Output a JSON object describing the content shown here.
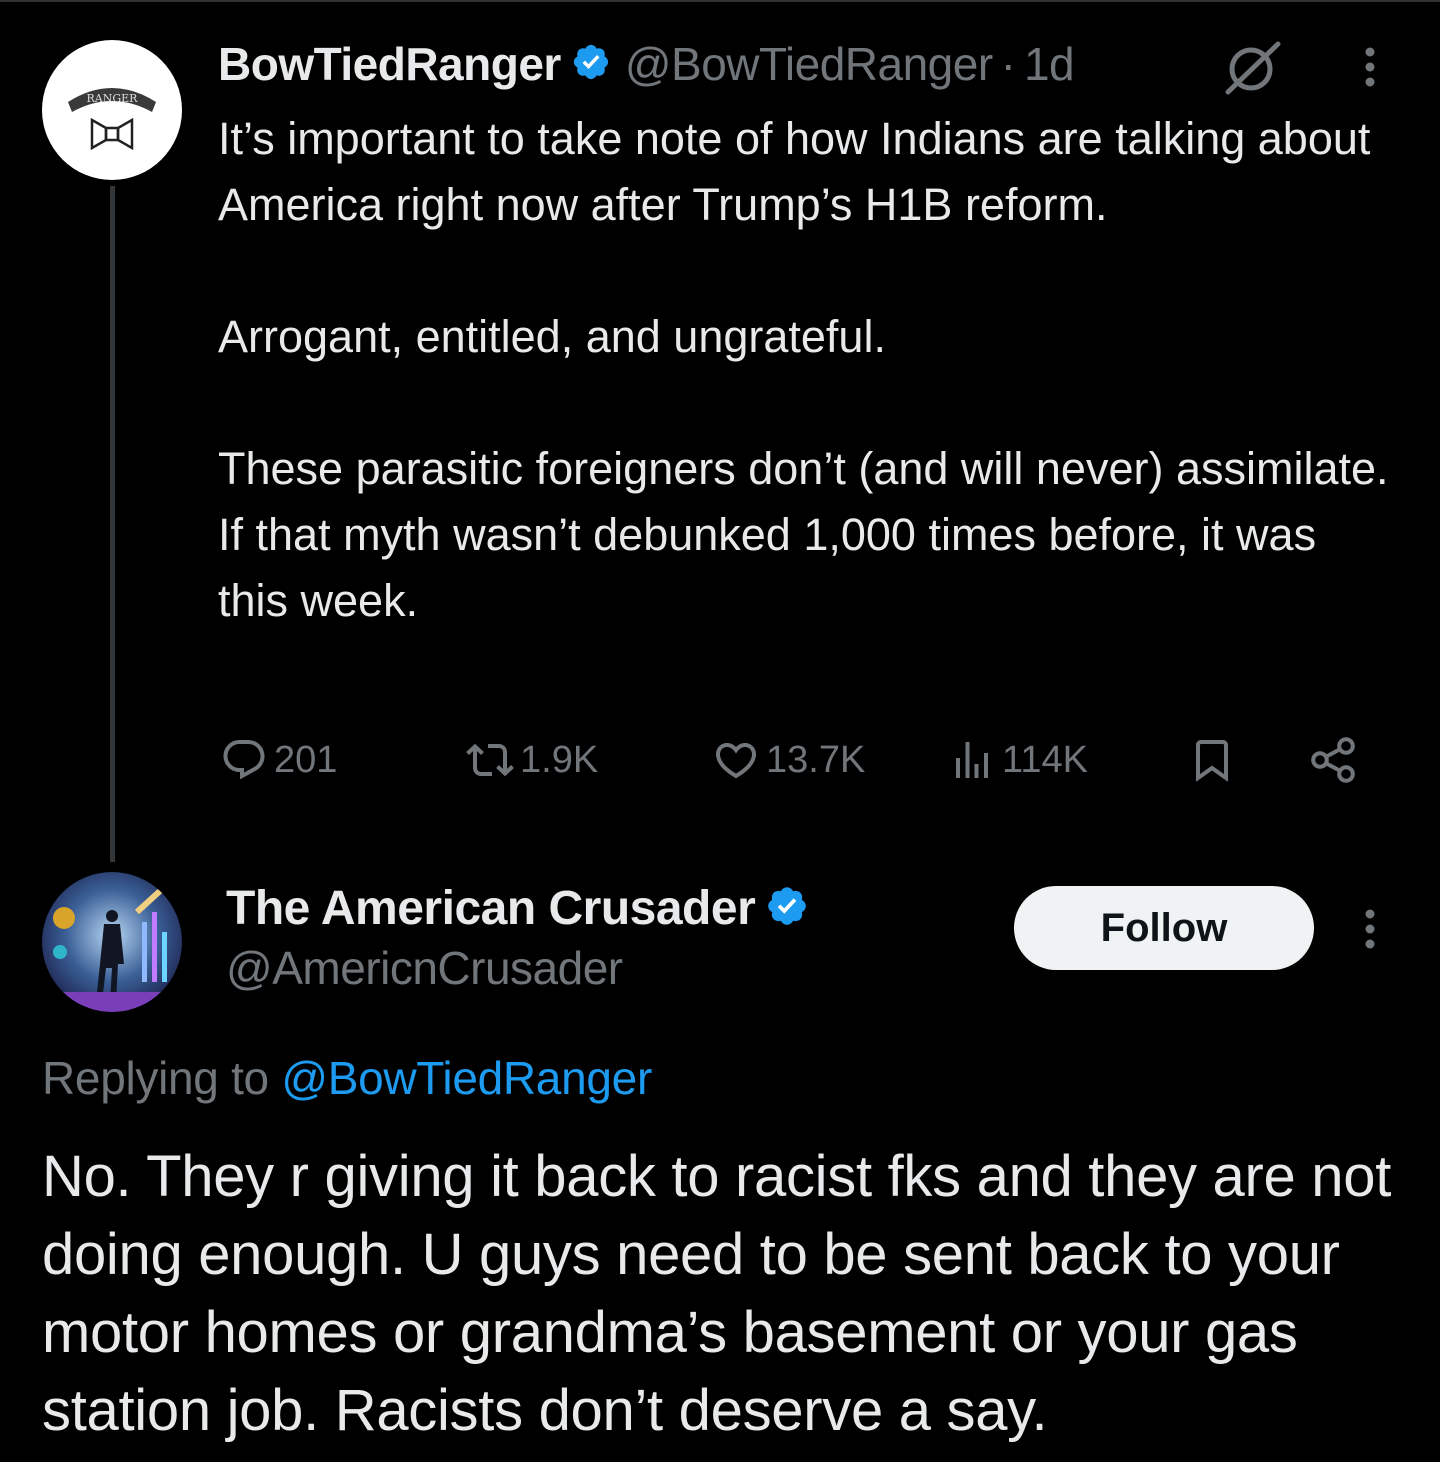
{
  "colors": {
    "background": "#000000",
    "text_primary": "#e7e9ea",
    "text_secondary": "#71767b",
    "accent_blue": "#1d9bf0",
    "verified_badge": "#1d9bf0",
    "follow_button_bg": "#eff3f4"
  },
  "parent_tweet": {
    "author_name": "BowTiedRanger",
    "author_handle": "@BowTiedRanger",
    "separator": "·",
    "time": "1d",
    "avatar_text": "RANGER",
    "body": [
      "It’s important to take note of how Indians are talking about America right now after Trump’s H1B reform.",
      "Arrogant, entitled, and ungrateful.",
      "These parasitic foreigners don’t (and will never) assimilate. If that myth wasn’t debunked 1,000 times before, it was this week."
    ],
    "actions": {
      "replies": "201",
      "reposts": "1.9K",
      "likes": "13.7K",
      "views": "114K"
    },
    "icons": [
      "grok-icon",
      "more-icon",
      "reply-icon",
      "repost-icon",
      "like-icon",
      "views-icon",
      "bookmark-icon",
      "share-icon"
    ]
  },
  "reply_tweet": {
    "author_name": "The American Crusader",
    "author_handle": "@AmericnCrusader",
    "follow_label": "Follow",
    "replying_prefix": "Replying to",
    "replying_to": "@BowTiedRanger",
    "body": "No. They r giving it back to racist fks and they are not doing enough. U guys need to be sent back to your motor homes or grandma’s basement or your gas station job. Racists don’t deserve a say."
  }
}
